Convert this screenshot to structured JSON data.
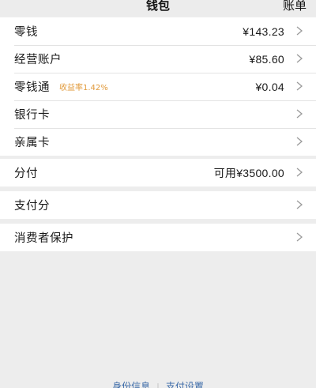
{
  "header": {
    "title": "钱包",
    "action": "账单"
  },
  "group1": [
    {
      "label": "零钱",
      "value": "¥143.23"
    },
    {
      "label": "经营账户",
      "value": "¥85.60"
    },
    {
      "label": "零钱通",
      "tag": "收益率1.42%",
      "value": "¥0.04"
    },
    {
      "label": "银行卡"
    },
    {
      "label": "亲属卡"
    }
  ],
  "group2": [
    {
      "label": "分付",
      "value": "可用¥3500.00"
    }
  ],
  "group3": [
    {
      "label": "支付分"
    }
  ],
  "group4": [
    {
      "label": "消费者保护"
    }
  ],
  "footer": {
    "identity": "身份信息",
    "pay_settings": "支付设置"
  },
  "colors": {
    "tag": "#e19a3b",
    "link": "#3b6aa8",
    "background": "#ededed"
  },
  "icons": {
    "row_arrow": "chevron-right-icon"
  }
}
